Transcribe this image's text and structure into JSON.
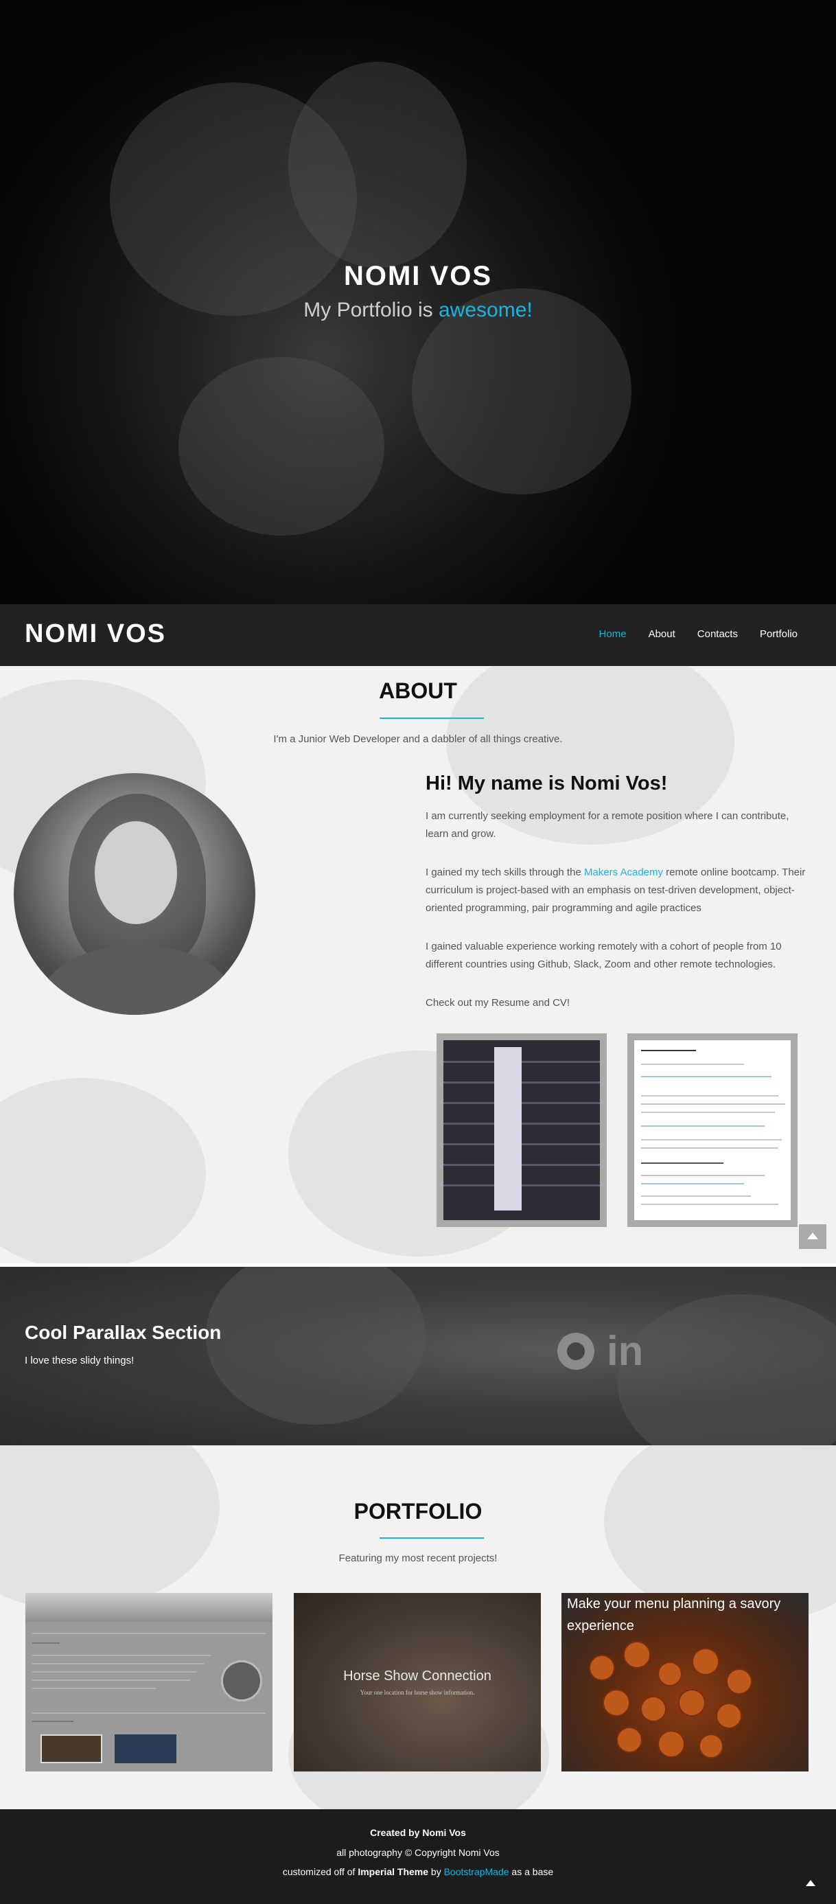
{
  "hero": {
    "title": "NOMI VOS",
    "subtitle_prefix": "My Portfolio is ",
    "subtitle_accent": "awesome!"
  },
  "nav": {
    "brand": "NOMI VOS",
    "items": [
      {
        "label": "Home",
        "active": true
      },
      {
        "label": "About",
        "active": false
      },
      {
        "label": "Contacts",
        "active": false
      },
      {
        "label": "Portfolio",
        "active": false
      }
    ]
  },
  "about": {
    "title": "ABOUT",
    "description": "I'm a Junior Web Developer and a dabbler of all things creative.",
    "heading": "Hi! My name is Nomi Vos!",
    "para1": "I am currently seeking employment for a remote position where I can contribute, learn and grow.",
    "para2_before": "I gained my tech skills through the ",
    "para2_link": "Makers Academy",
    "para2_after": " remote online bootcamp. Their curriculum is project-based with an emphasis on test-driven development, object-oriented programming, pair programming and agile practices",
    "para3": "I gained valuable experience working remotely with a cohort of people from 10 different countries using Github, Slack, Zoom and other remote technologies.",
    "para4": "Check out my Resume and CV!"
  },
  "parallax": {
    "title": "Cool Parallax Section",
    "subtitle": "I love these slidy things!",
    "linkedin_text": "in"
  },
  "portfolio": {
    "title": "PORTFOLIO",
    "description": "Featuring my most recent projects!",
    "cards": [
      {
        "title": ""
      },
      {
        "title": "Horse Show Connection",
        "subtitle": "Your one location for horse show information."
      },
      {
        "title": "Make your menu planning a savory experience"
      }
    ]
  },
  "footer": {
    "line1_prefix": "Created by ",
    "line1_name": "Nomi Vos",
    "line2": "all photography © Copyright Nomi Vos",
    "line3_prefix": "customized off of ",
    "line3_theme": "Imperial Theme",
    "line3_by": " by ",
    "line3_link": "BootstrapMade",
    "line3_suffix": " as a base"
  },
  "colors": {
    "accent": "#18b4de",
    "nav_bg": "#222222",
    "footer_bg": "#1c1c1c"
  },
  "icons": [
    "github-icon",
    "linkedin-icon",
    "chevron-up-icon"
  ]
}
